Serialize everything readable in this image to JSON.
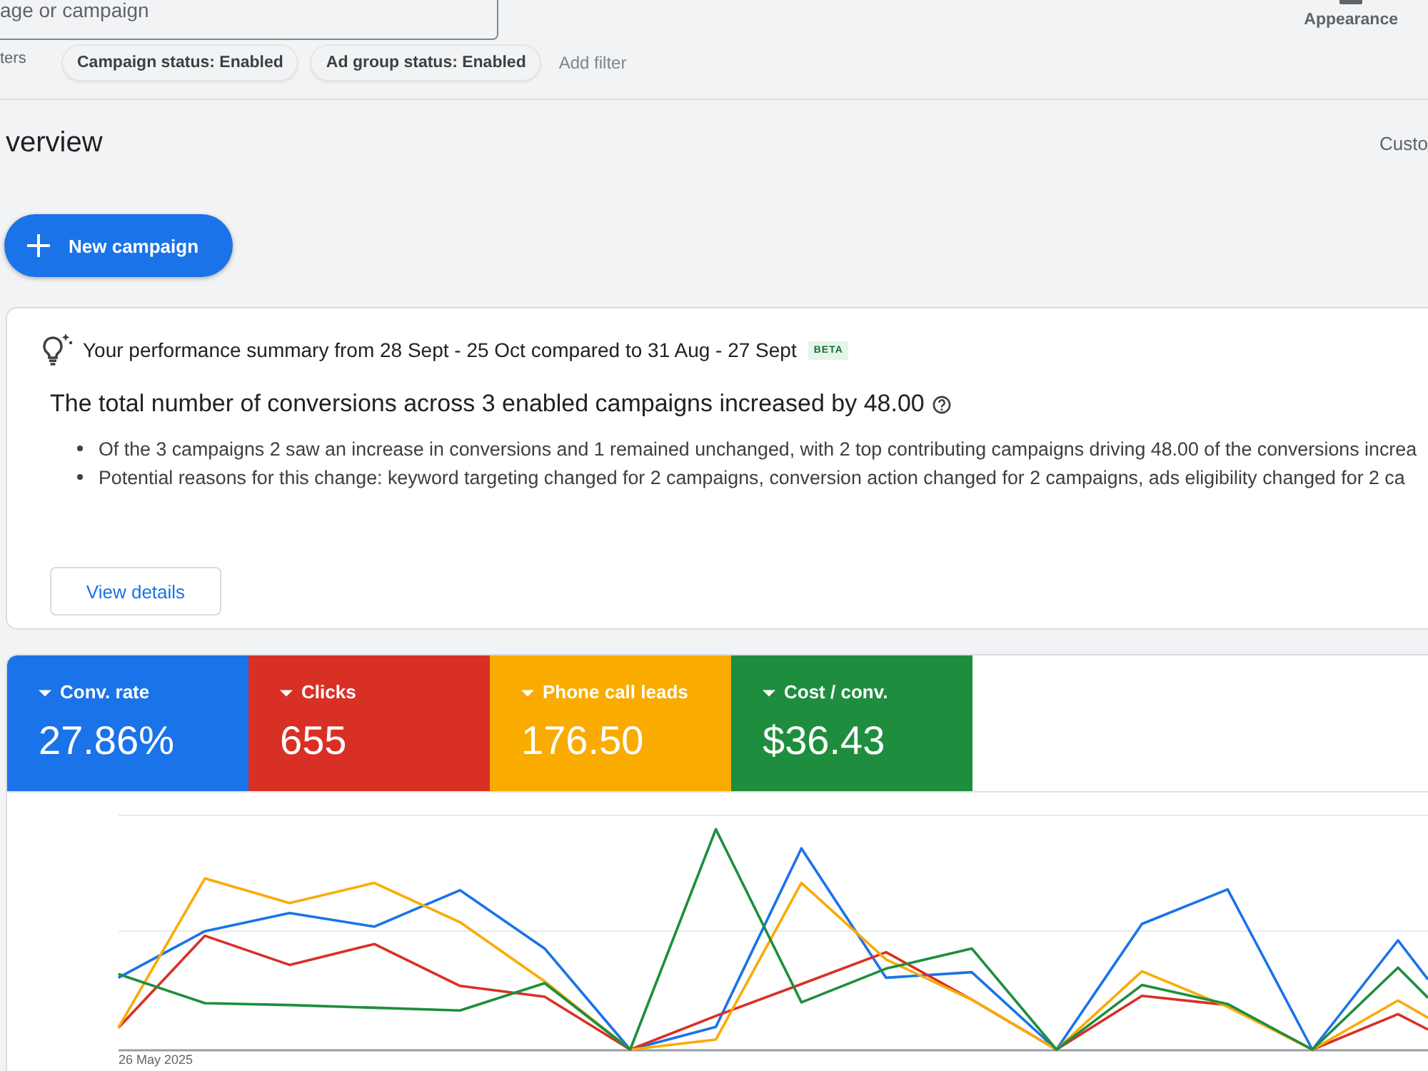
{
  "search": {
    "placeholder": "age or campaign"
  },
  "filters": {
    "label": "ters",
    "chips": [
      "Campaign status: Enabled",
      "Ad group status: Enabled"
    ],
    "add_filter": "Add filter"
  },
  "appearance": {
    "label": "Appearance"
  },
  "header": {
    "title": "verview",
    "right_label": "Custo"
  },
  "new_campaign": {
    "label": "New campaign"
  },
  "summary": {
    "title": "Your performance summary from 28 Sept - 25 Oct compared to 31 Aug - 27 Sept",
    "badge": "BETA",
    "headline": "The total number of conversions across 3 enabled campaigns increased by 48.00",
    "bullets": [
      "Of the 3 campaigns 2 saw an increase in conversions and 1 remained unchanged, with 2 top contributing campaigns driving 48.00 of the conversions increa",
      "Potential reasons for this change: keyword targeting changed for 2 campaigns, conversion action changed for 2 campaigns, ads eligibility changed for 2 ca"
    ],
    "button": "View details"
  },
  "metrics": [
    {
      "label": "Conv. rate",
      "value": "27.86%",
      "selected": true,
      "color": "#1a73e8"
    },
    {
      "label": "Clicks",
      "value": "655",
      "selected": true,
      "color": "#d93025"
    },
    {
      "label": "Phone call leads",
      "value": "176.50",
      "selected": true,
      "color": "#f9ab00"
    },
    {
      "label": "Cost / conv.",
      "value": "$36.43",
      "selected": true,
      "color": "#1e8e3e"
    }
  ],
  "chart": {
    "start_label": "26 May 2025"
  }
}
